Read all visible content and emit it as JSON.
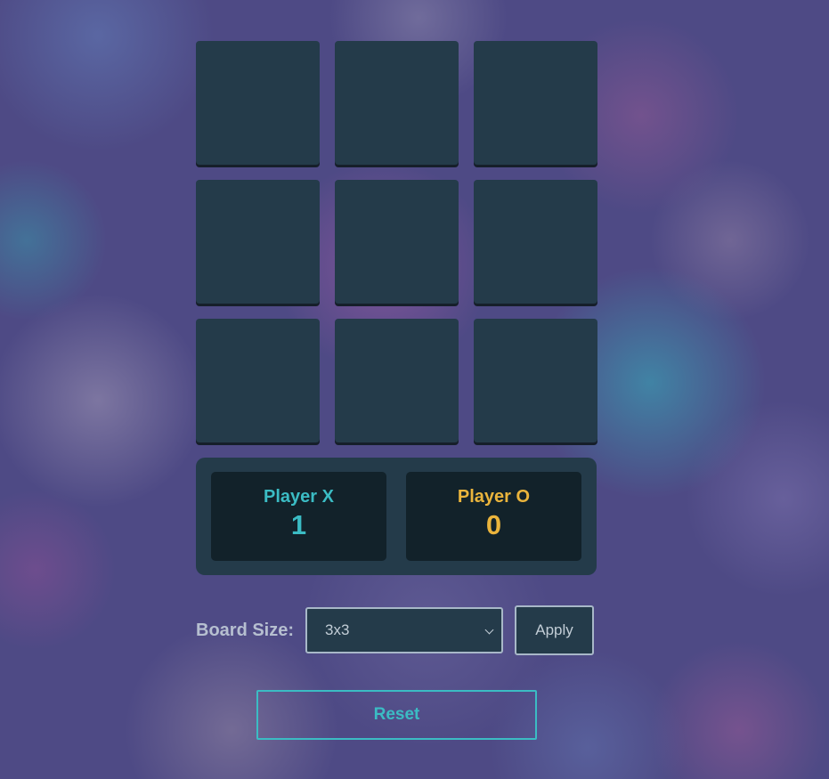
{
  "board": {
    "cells": [
      "",
      "",
      "",
      "",
      "",
      "",
      "",
      "",
      ""
    ]
  },
  "scoreboard": {
    "player_x": {
      "name": "Player X",
      "score": "1",
      "color": "#3bbcc4"
    },
    "player_o": {
      "name": "Player O",
      "score": "0",
      "color": "#eab43c"
    }
  },
  "settings": {
    "board_size_label": "Board Size:",
    "board_size_selected": "3x3",
    "apply_label": "Apply"
  },
  "reset": {
    "label": "Reset",
    "color": "#3bbcc4"
  }
}
